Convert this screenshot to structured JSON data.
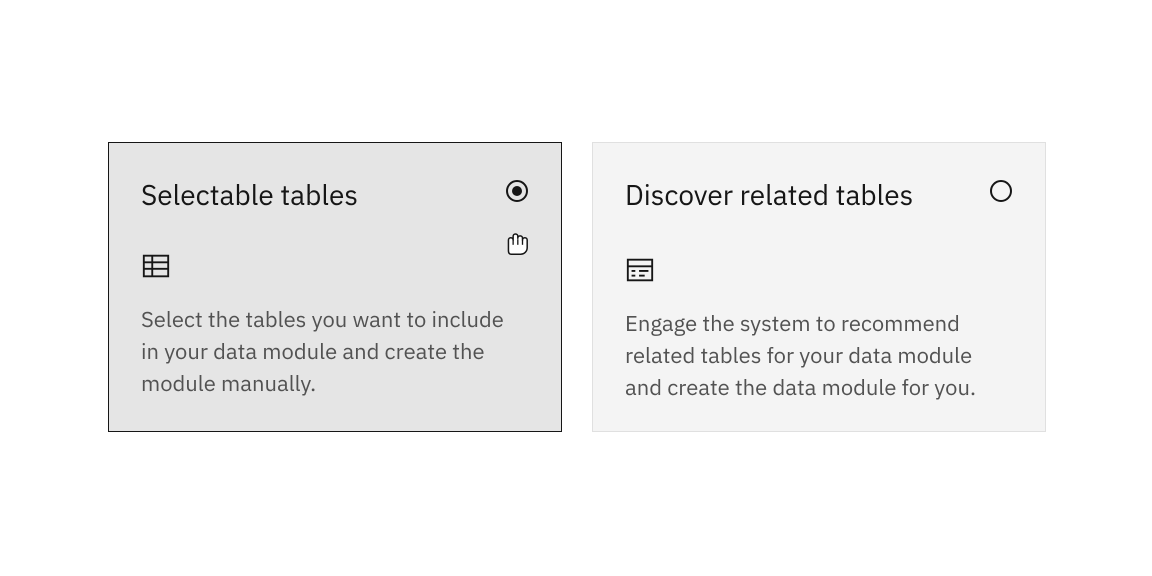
{
  "tiles": [
    {
      "title": "Selectable tables",
      "description": "Select the tables you want to include in your data module and create the module manually.",
      "selected": true
    },
    {
      "title": "Discover related tables",
      "description": "Engage the system to recommend related tables for your data module and create the data module for you.",
      "selected": false
    }
  ]
}
